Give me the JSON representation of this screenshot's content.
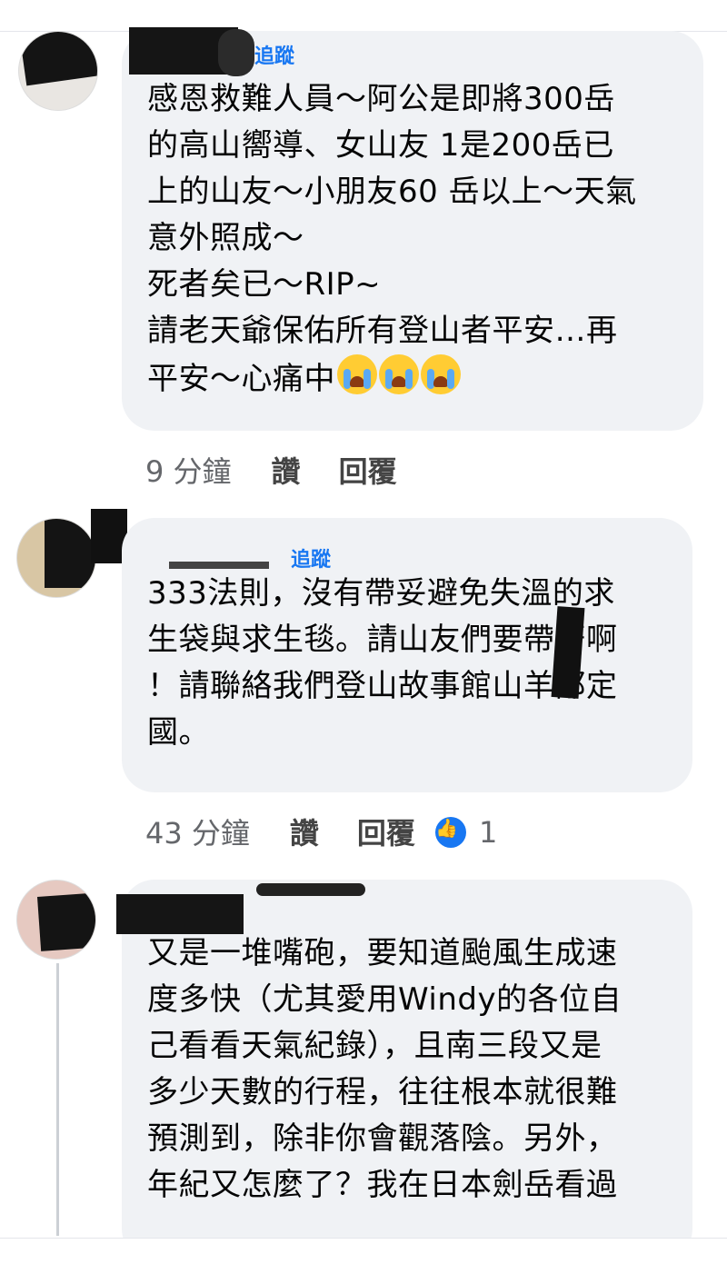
{
  "comments": [
    {
      "follow_label": "追蹤",
      "text": "感恩救難人員～阿公是即將300岳\n的高山嚮導、女山友 1是200岳已\n上的山友～小朋友60 岳以上～天氣\n意外照成～\n死者矣已～RIP~\n請老天爺保佑所有登山者平安…再\n平安～心痛中",
      "emoji": "crying-face",
      "time": "9 分鐘",
      "like_label": "讚",
      "reply_label": "回覆"
    },
    {
      "follow_label": "追蹤",
      "text": "333法則，沒有帶妥避免失溫的求\n生袋與求生毯。請山友們要帶著啊\n！請聯絡我們登山故事館山羊邵定\n國。",
      "time": "43 分鐘",
      "like_label": "讚",
      "reply_label": "回覆",
      "reaction_count": "1"
    },
    {
      "text": "又是一堆嘴砲，要知道颱風生成速\n度多快（尤其愛用Windy的各位自\n己看看天氣紀錄），且南三段又是\n多少天數的行程，往往根本就很難\n預測到，除非你會觀落陰。另外，\n年紀又怎麼了？我在日本劍岳看過"
    }
  ],
  "colors": {
    "bubble": "#f0f2f5",
    "accent": "#1877f2",
    "meta": "#65676b"
  }
}
